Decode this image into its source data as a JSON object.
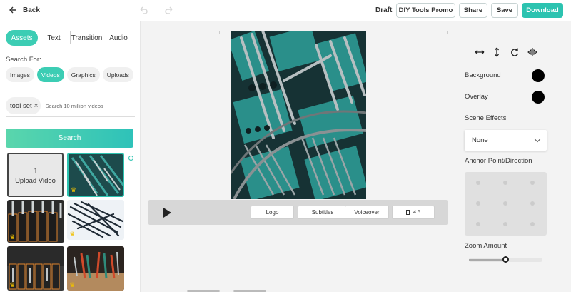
{
  "topbar": {
    "back_label": "Back",
    "draft_label": "Draft",
    "project_name": "DIY Tools Promo",
    "share_label": "Share",
    "save_label": "Save",
    "download_label": "Download"
  },
  "sidebar": {
    "tabs": [
      "Assets",
      "Text",
      "Transition",
      "Audio"
    ],
    "active_tab": "Assets",
    "search_for_label": "Search For:",
    "media_types": [
      "Images",
      "Videos",
      "Graphics",
      "Uploads"
    ],
    "active_media_type": "Videos",
    "search_tag": "tool set",
    "search_placeholder": "Search 10 million videos",
    "search_button": "Search",
    "upload_label": "Upload Video",
    "thumbnails": [
      {
        "premium": true
      },
      {
        "premium": true
      },
      {
        "premium": true
      },
      {
        "premium": true
      },
      {
        "premium": true
      }
    ]
  },
  "controls": {
    "logo": "Logo",
    "subtitles": "Subtitles",
    "voiceover": "Voiceover",
    "ratio": "4:5"
  },
  "properties": {
    "background_label": "Background",
    "background_color": "#000000",
    "overlay_label": "Overlay",
    "overlay_color": "#000000",
    "scene_effects_label": "Scene Effects",
    "scene_effect_value": "None",
    "anchor_label": "Anchor Point/Direction",
    "zoom_label": "Zoom Amount",
    "zoom_value": 0.5
  },
  "colors": {
    "accent": "#2cc3b0",
    "accent_light": "#3ccdb4",
    "premium_crown": "#f0c000"
  },
  "icons": [
    "arrow-left-icon",
    "undo-icon",
    "redo-icon",
    "flip-horizontal-icon",
    "flip-vertical-icon",
    "rotate-icon",
    "mirror-icon",
    "play-icon",
    "crown-icon",
    "upload-arrow-icon",
    "chevron-down-icon",
    "close-icon"
  ]
}
